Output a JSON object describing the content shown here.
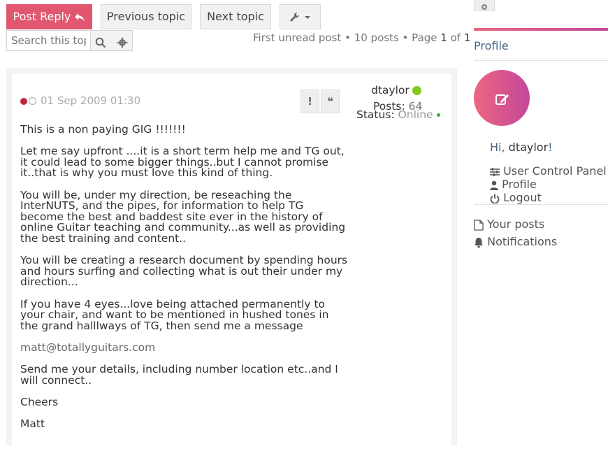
{
  "toolbar": {
    "post_reply": "Post Reply",
    "previous_topic": "Previous topic",
    "next_topic": "Next topic"
  },
  "search": {
    "placeholder": "Search this topic…"
  },
  "pagination": {
    "first_unread": "First unread post",
    "posts_count": "10 posts",
    "page_label": "Page",
    "page_current": "1",
    "page_of": "of",
    "page_total": "1"
  },
  "post": {
    "date": "01 Sep 2009 01:30",
    "report_icon": "!",
    "quote_icon": "❝",
    "paragraphs": [
      "This is a non paying GIG !!!!!!!",
      "Let me say upfront ....it is a short term help me and TG out, it could lead to some bigger things..but I cannot promise it..that is why you must love this kind of thing.",
      "You will be, under my direction, be reseaching the InterNUTS, and the pipes, for information to help TG become the best and baddest site ever in the history of online Guitar teaching and community...as well as providing the best training and content..",
      "You will be creating a research document by spending hours and hours surfing and collecting what is out their under my direction...",
      "If you have 4 eyes...love being attached permanently to your chair, and want to be mentioned in hushed tones in the grand halllways of TG, then send me a message"
    ],
    "email": "matt@totallyguitars.com",
    "paragraphs_after": [
      "Send me your details, including number location etc..and I will connect..",
      "Cheers",
      "Matt"
    ]
  },
  "author": {
    "name": "dtaylor",
    "posts_label": "Posts:",
    "posts_value": "64",
    "status_label": "Status:",
    "status_value": "Online"
  },
  "sidebar": {
    "title": "Profile",
    "hi": "Hi,",
    "username": "dtaylor",
    "exclaim": "!",
    "links": {
      "ucp": "User Control Panel",
      "profile": "Profile",
      "logout": "Logout",
      "your_posts": "Your posts",
      "notifications": "Notifications"
    }
  },
  "colors": {
    "accent": "#e0576f",
    "online": "#82c91e",
    "unread": "#c2263f"
  }
}
